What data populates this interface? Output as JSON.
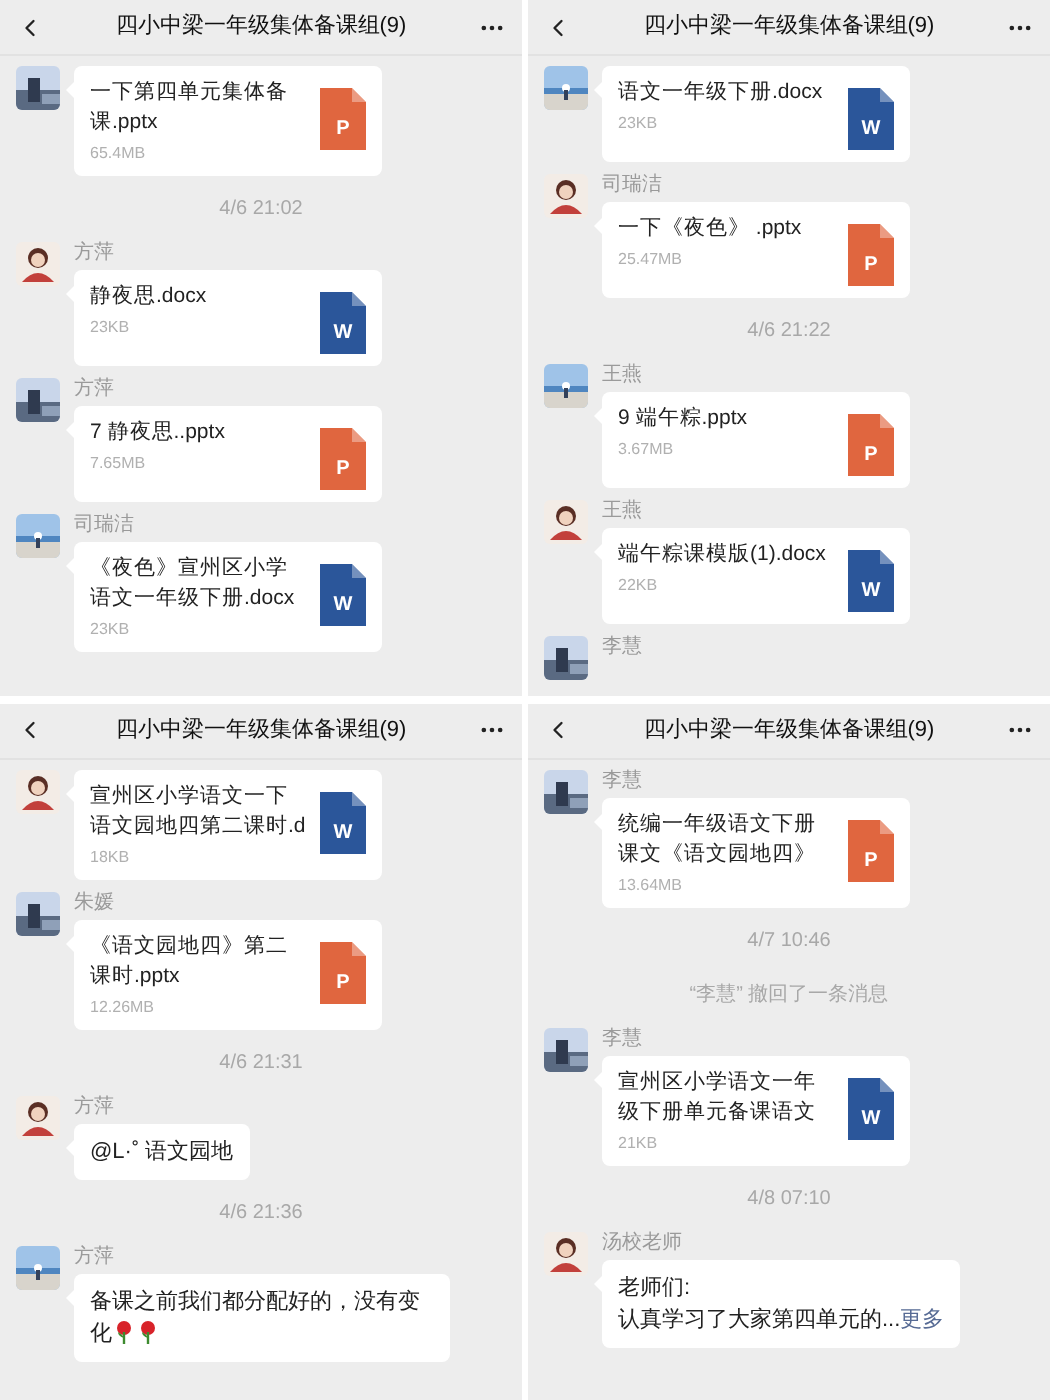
{
  "panels": [
    {
      "title": "四小中梁一年级集体备课组(9)",
      "messages": [
        {
          "kind": "file",
          "name": "一下第四单元集体备课.pptx",
          "size": "65.4MB",
          "color": "#e0663f",
          "icon_letter": "P"
        },
        {
          "kind": "time",
          "text": "4/6 21:02"
        },
        {
          "kind": "file",
          "sender": "方萍",
          "name": "静夜思.docx",
          "size": "23KB",
          "color": "#2b569a",
          "icon_letter": "W"
        },
        {
          "kind": "file",
          "sender": "方萍",
          "name": "7 静夜思..pptx",
          "size": "7.65MB",
          "color": "#e0663f",
          "icon_letter": "P"
        },
        {
          "kind": "file",
          "sender": "司瑞洁",
          "name": "《夜色》宣州区小学语文一年级下册.docx",
          "size": "23KB",
          "color": "#2b569a",
          "icon_letter": "W"
        }
      ]
    },
    {
      "title": "四小中梁一年级集体备课组(9)",
      "messages": [
        {
          "kind": "file",
          "name": "语文一年级下册.docx",
          "size": "23KB",
          "color": "#2b569a",
          "icon_letter": "W"
        },
        {
          "kind": "file",
          "sender": "司瑞洁",
          "name": "一下《夜色》 .pptx",
          "size": "25.47MB",
          "color": "#e0663f",
          "icon_letter": "P"
        },
        {
          "kind": "time",
          "text": "4/6 21:22"
        },
        {
          "kind": "file",
          "sender": "王燕",
          "name": "9 端午粽.pptx",
          "size": "3.67MB",
          "color": "#e0663f",
          "icon_letter": "P"
        },
        {
          "kind": "file",
          "sender": "王燕",
          "name": "端午粽课模版(1).docx",
          "size": "22KB",
          "color": "#2b569a",
          "icon_letter": "W"
        },
        {
          "kind": "sender_only",
          "sender": "李慧"
        }
      ]
    },
    {
      "title": "四小中梁一年级集体备课组(9)",
      "messages": [
        {
          "kind": "file",
          "name": "宣州区小学语文一下语文园地四第二课时.d",
          "size": "18KB",
          "color": "#2b569a",
          "icon_letter": "W"
        },
        {
          "kind": "file",
          "sender": "朱媛",
          "name": "《语文园地四》第二课时.pptx",
          "size": "12.26MB",
          "color": "#e0663f",
          "icon_letter": "P"
        },
        {
          "kind": "time",
          "text": "4/6 21:31"
        },
        {
          "kind": "text",
          "sender": "方萍",
          "lines": [
            "@L·˚ 语文园地"
          ]
        },
        {
          "kind": "time",
          "text": "4/6 21:36"
        },
        {
          "kind": "text",
          "sender": "方萍",
          "lines": [
            "备课之前我们都分配好的，没有变化"
          ],
          "emoji": [
            {
              "kind": "rose"
            },
            {
              "kind": "rose"
            }
          ]
        }
      ]
    },
    {
      "title": "四小中梁一年级集体备课组(9)",
      "messages": [
        {
          "kind": "file",
          "sender": "李慧",
          "name": "统编一年级语文下册课文《语文园地四》",
          "size": "13.64MB",
          "color": "#e0663f",
          "icon_letter": "P"
        },
        {
          "kind": "time",
          "text": "4/7 10:46"
        },
        {
          "kind": "notice",
          "text": "“李慧” 撤回了一条消息"
        },
        {
          "kind": "file",
          "sender": "李慧",
          "name": "宣州区小学语文一年级下册单元备课语文",
          "size": "21KB",
          "color": "#2b569a",
          "icon_letter": "W"
        },
        {
          "kind": "time",
          "text": "4/8 07:10"
        },
        {
          "kind": "text",
          "sender": "汤校老师",
          "lines": [
            "老师们:",
            "认真学习了大家第四单元的..."
          ],
          "more": "更多"
        }
      ]
    }
  ]
}
